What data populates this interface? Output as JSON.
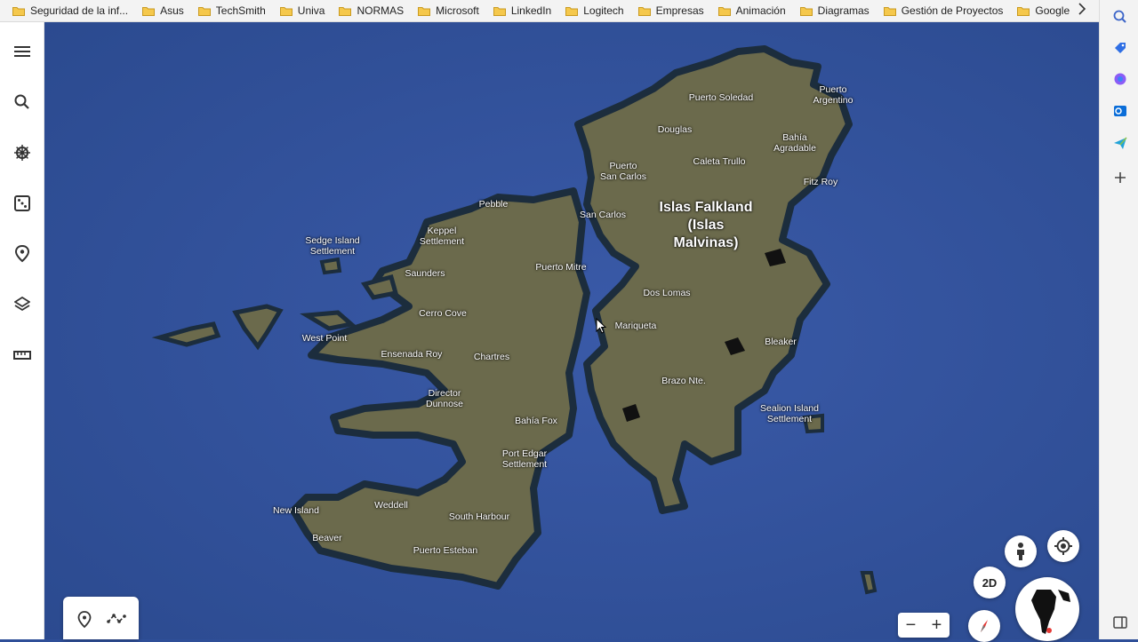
{
  "bookmarks": {
    "items": [
      "Seguridad de la inf...",
      "Asus",
      "TechSmith",
      "Univa",
      "NORMAS",
      "Microsoft",
      "LinkedIn",
      "Logitech",
      "Empresas",
      "Animación",
      "Diagramas",
      "Gestión de Proyectos",
      "Google"
    ],
    "more_icon": "chevron-right-icon"
  },
  "left_rail": {
    "icons": [
      "menu-icon",
      "search-icon",
      "voyager-wheel-icon",
      "dice-icon",
      "map-pin-icon",
      "layers-icon",
      "ruler-icon"
    ]
  },
  "edge_sidebar": {
    "icons": [
      "search-icon",
      "tag-icon",
      "copilot-icon",
      "outlook-icon",
      "send-icon",
      "add-icon",
      "panel-icon"
    ]
  },
  "map": {
    "labels": [
      {
        "id": "puerto-soledad",
        "text": "Puerto Soledad"
      },
      {
        "id": "puerto-argentino",
        "text": "Puerto\nArgentino"
      },
      {
        "id": "douglas",
        "text": "Douglas"
      },
      {
        "id": "bahia-agradable",
        "text": "Bahía\nAgradable"
      },
      {
        "id": "caleta-trullo",
        "text": "Caleta Trullo"
      },
      {
        "id": "puerto-san-carlos",
        "text": "Puerto\nSan Carlos"
      },
      {
        "id": "fitz-roy",
        "text": "Fitz Roy"
      },
      {
        "id": "pebble",
        "text": "Pebble"
      },
      {
        "id": "san-carlos",
        "text": "San Carlos"
      },
      {
        "id": "islas-falkland",
        "text": "Islas Falkland\n(Islas\nMalvinas)",
        "big": true
      },
      {
        "id": "keppel",
        "text": "Keppel\nSettlement"
      },
      {
        "id": "sedge-island",
        "text": "Sedge Island\nSettlement"
      },
      {
        "id": "puerto-mitre",
        "text": "Puerto Mitre"
      },
      {
        "id": "saunders",
        "text": "Saunders"
      },
      {
        "id": "dos-lomas",
        "text": "Dos Lomas"
      },
      {
        "id": "cerro-cove",
        "text": "Cerro Cove"
      },
      {
        "id": "mariqueta",
        "text": "Mariqueta"
      },
      {
        "id": "west-point",
        "text": "West Point"
      },
      {
        "id": "bleaker",
        "text": "Bleaker"
      },
      {
        "id": "ensenada-roy",
        "text": "Ensenada Roy"
      },
      {
        "id": "chartres",
        "text": "Chartres"
      },
      {
        "id": "brazo-nte",
        "text": "Brazo Nte."
      },
      {
        "id": "director-dunnose",
        "text": "Director\nDunnose"
      },
      {
        "id": "sealion-island",
        "text": "Sealion Island\nSettlement"
      },
      {
        "id": "bahia-fox",
        "text": "Bahía Fox"
      },
      {
        "id": "port-edgar",
        "text": "Port Edgar\nSettlement"
      },
      {
        "id": "weddell",
        "text": "Weddell"
      },
      {
        "id": "new-island",
        "text": "New Island"
      },
      {
        "id": "south-harbour",
        "text": "South Harbour"
      },
      {
        "id": "beaver",
        "text": "Beaver"
      },
      {
        "id": "puerto-esteban",
        "text": "Puerto Esteban"
      }
    ]
  },
  "controls": {
    "mode_button": "2D",
    "zoom_out": "−",
    "zoom_in": "+",
    "tool_icons": [
      "add-placemark-icon",
      "draw-path-icon"
    ],
    "pegman_icon": "pegman-icon",
    "locate_icon": "my-location-icon",
    "compass_icon": "compass-icon",
    "globe_icon": "globe-icon"
  },
  "colors": {
    "ocean": "#2f4f98",
    "land": "#6b6a4c",
    "coast": "#1c2d3d"
  }
}
